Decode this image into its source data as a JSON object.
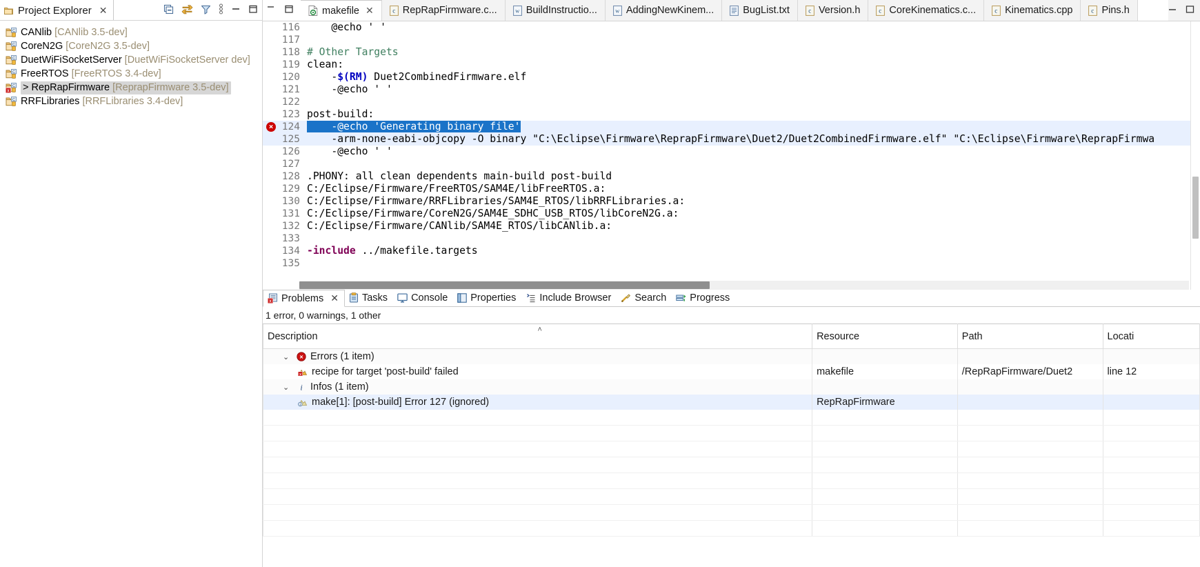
{
  "project_explorer": {
    "tab_label": "Project Explorer",
    "close_label": "✕",
    "toolbar": [
      {
        "name": "collapse-all-icon",
        "title": "Collapse All"
      },
      {
        "name": "link-with-editor-icon",
        "title": "Link with Editor"
      },
      {
        "name": "filter-icon",
        "title": "Filters and Customization"
      },
      {
        "name": "view-menu-icon",
        "title": "View Menu"
      },
      {
        "name": "minimize-icon",
        "title": "Minimize"
      },
      {
        "name": "maximize-icon",
        "title": "Maximize"
      }
    ],
    "projects": [
      {
        "name": "CANlib",
        "branch": "[CANlib 3.5-dev]",
        "selected": false,
        "error": false,
        "prefix": ""
      },
      {
        "name": "CoreN2G",
        "branch": "[CoreN2G 3.5-dev]",
        "selected": false,
        "error": false,
        "prefix": ""
      },
      {
        "name": "DuetWiFiSocketServer",
        "branch": "[DuetWiFiSocketServer dev]",
        "selected": false,
        "error": false,
        "prefix": ""
      },
      {
        "name": "FreeRTOS",
        "branch": "[FreeRTOS 3.4-dev]",
        "selected": false,
        "error": false,
        "prefix": ""
      },
      {
        "name": "RepRapFirmware",
        "branch": "[ReprapFirmware 3.5-dev]",
        "selected": true,
        "error": true,
        "prefix": "> "
      },
      {
        "name": "RRFLibraries",
        "branch": "[RRFLibraries 3.4-dev]",
        "selected": false,
        "error": false,
        "prefix": ""
      }
    ]
  },
  "editor_tabs": [
    {
      "label": "makefile",
      "icon": "makefile-icon",
      "active": true,
      "closable": true
    },
    {
      "label": "RepRapFirmware.c...",
      "icon": "c-source-icon",
      "active": false,
      "closable": false
    },
    {
      "label": "BuildInstructio...",
      "icon": "word-doc-icon",
      "active": false,
      "closable": false
    },
    {
      "label": "AddingNewKinem...",
      "icon": "word-doc-icon",
      "active": false,
      "closable": false
    },
    {
      "label": "BugList.txt",
      "icon": "text-file-icon",
      "active": false,
      "closable": false
    },
    {
      "label": "Version.h",
      "icon": "c-source-icon",
      "active": false,
      "closable": false
    },
    {
      "label": "CoreKinematics.c...",
      "icon": "c-source-icon",
      "active": false,
      "closable": false
    },
    {
      "label": "Kinematics.cpp",
      "icon": "c-source-icon",
      "active": false,
      "closable": false
    },
    {
      "label": "Pins.h",
      "icon": "c-source-icon",
      "active": false,
      "closable": false
    }
  ],
  "editor": {
    "first_line": 116,
    "lines": [
      {
        "n": 116,
        "segments": [
          {
            "t": "    @echo ' '",
            "c": ""
          }
        ]
      },
      {
        "n": 117,
        "segments": [
          {
            "t": "",
            "c": ""
          }
        ]
      },
      {
        "n": 118,
        "segments": [
          {
            "t": "# Other Targets",
            "c": "comment"
          }
        ]
      },
      {
        "n": 119,
        "segments": [
          {
            "t": "clean:",
            "c": ""
          }
        ]
      },
      {
        "n": 120,
        "segments": [
          {
            "t": "    -",
            "c": ""
          },
          {
            "t": "$(RM)",
            "c": "var"
          },
          {
            "t": " Duet2CombinedFirmware.elf",
            "c": ""
          }
        ]
      },
      {
        "n": 121,
        "segments": [
          {
            "t": "    -@echo ' '",
            "c": ""
          }
        ]
      },
      {
        "n": 122,
        "segments": [
          {
            "t": "",
            "c": ""
          }
        ]
      },
      {
        "n": 123,
        "segments": [
          {
            "t": "post-build:",
            "c": ""
          }
        ]
      },
      {
        "n": 124,
        "selected": true,
        "error": true,
        "current": true,
        "segments": [
          {
            "t": "    -@echo 'Generating binary file'",
            "c": "sel"
          }
        ]
      },
      {
        "n": 125,
        "current": true,
        "segments": [
          {
            "t": "    -arm-none-eabi-objcopy -O binary \"C:\\Eclipse\\Firmware\\ReprapFirmware\\Duet2/Duet2CombinedFirmware.elf\" \"C:\\Eclipse\\Firmware\\ReprapFirmwa",
            "c": ""
          }
        ]
      },
      {
        "n": 126,
        "segments": [
          {
            "t": "    -@echo ' '",
            "c": ""
          }
        ]
      },
      {
        "n": 127,
        "segments": [
          {
            "t": "",
            "c": ""
          }
        ]
      },
      {
        "n": 128,
        "segments": [
          {
            "t": ".PHONY: all clean dependents main-build post-build",
            "c": ""
          }
        ]
      },
      {
        "n": 129,
        "segments": [
          {
            "t": "C:/Eclipse/Firmware/FreeRTOS/SAM4E/libFreeRTOS.a:",
            "c": ""
          }
        ]
      },
      {
        "n": 130,
        "segments": [
          {
            "t": "C:/Eclipse/Firmware/RRFLibraries/SAM4E_RTOS/libRRFLibraries.a:",
            "c": ""
          }
        ]
      },
      {
        "n": 131,
        "segments": [
          {
            "t": "C:/Eclipse/Firmware/CoreN2G/SAM4E_SDHC_USB_RTOS/libCoreN2G.a:",
            "c": ""
          }
        ]
      },
      {
        "n": 132,
        "segments": [
          {
            "t": "C:/Eclipse/Firmware/CANlib/SAM4E_RTOS/libCANlib.a:",
            "c": ""
          }
        ]
      },
      {
        "n": 133,
        "segments": [
          {
            "t": "",
            "c": ""
          }
        ]
      },
      {
        "n": 134,
        "segments": [
          {
            "t": "-include",
            "c": "kw"
          },
          {
            "t": " ../makefile.targets",
            "c": ""
          }
        ]
      },
      {
        "n": 135,
        "segments": [
          {
            "t": "",
            "c": ""
          }
        ]
      }
    ]
  },
  "problems_panel": {
    "tabs": [
      {
        "label": "Problems",
        "icon": "problems-icon",
        "active": true,
        "closable": true
      },
      {
        "label": "Tasks",
        "icon": "tasks-icon",
        "active": false,
        "closable": false
      },
      {
        "label": "Console",
        "icon": "console-icon",
        "active": false,
        "closable": false
      },
      {
        "label": "Properties",
        "icon": "properties-icon",
        "active": false,
        "closable": false
      },
      {
        "label": "Include Browser",
        "icon": "include-browser-icon",
        "active": false,
        "closable": false
      },
      {
        "label": "Search",
        "icon": "search-icon",
        "active": false,
        "closable": false
      },
      {
        "label": "Progress",
        "icon": "progress-icon",
        "active": false,
        "closable": false
      }
    ],
    "close_label": "✕",
    "summary": "1 error, 0 warnings, 1 other",
    "columns": [
      "Description",
      "Resource",
      "Path",
      "Locati"
    ],
    "sort_indicator": "˄",
    "sorted_column_index": 0,
    "rows": [
      {
        "kind": "group",
        "twisty": "⌄",
        "icon": "error-icon",
        "description": "Errors (1 item)",
        "resource": "",
        "path": "",
        "location": "",
        "selected": false
      },
      {
        "kind": "item",
        "twisty": "",
        "icon": "error-marker-icon",
        "description": "recipe for target 'post-build' failed",
        "resource": "makefile",
        "path": "/RepRapFirmware/Duet2",
        "location": "line 12",
        "selected": false
      },
      {
        "kind": "group",
        "twisty": "⌄",
        "icon": "info-icon",
        "description": "Infos (1 item)",
        "resource": "",
        "path": "",
        "location": "",
        "selected": false
      },
      {
        "kind": "item",
        "twisty": "",
        "icon": "info-marker-icon",
        "description": "make[1]: [post-build] Error 127 (ignored)",
        "resource": "RepRapFirmware",
        "path": "",
        "location": "",
        "selected": true
      }
    ],
    "empty_row_count": 8
  },
  "window_controls": {
    "minimize": "–",
    "maximize": "❐"
  },
  "colors": {
    "selection_blue": "#1a73c8",
    "current_line": "#e8f0fe",
    "error_red": "#cc0000",
    "comment_green": "#3f7f5f",
    "keyword_magenta": "#7f0055",
    "variable_blue": "#0000c0",
    "branch_gray": "#9a8e72",
    "tree_selection": "#d6d6d6"
  }
}
